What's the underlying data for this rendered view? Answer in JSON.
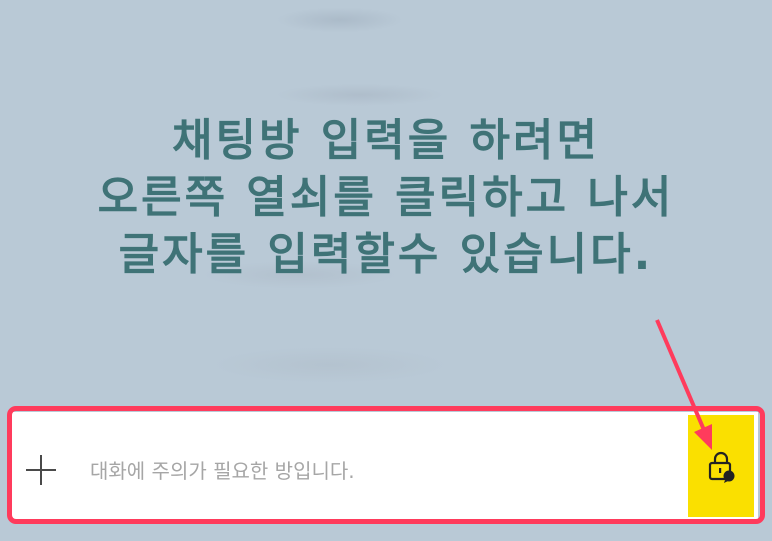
{
  "overlay": {
    "notice_lines": [
      "채팅방 입력을 하려면",
      "오른쪽 열쇠를 클릭하고 나서",
      "글자를 입력할수 있습니다."
    ],
    "highlight_color": "#ff3b5c",
    "notice_color": "#3f7377"
  },
  "composer": {
    "add_icon": "plus-icon",
    "placeholder": "대화에 주의가 필요한 방입니다.",
    "value": "",
    "lock_icon": "lock-chat-icon",
    "lock_button_color": "#fae000"
  }
}
